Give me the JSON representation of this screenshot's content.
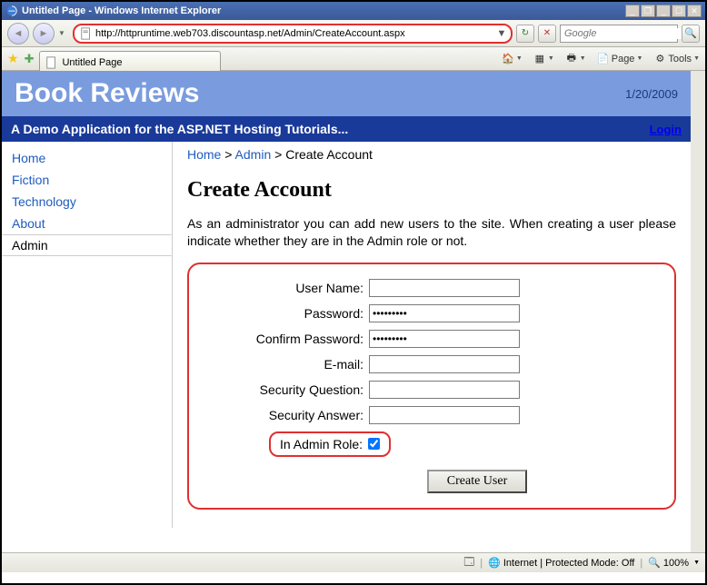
{
  "window": {
    "title": "Untitled Page - Windows Internet Explorer"
  },
  "address": {
    "url": "http://httpruntime.web703.discountasp.net/Admin/CreateAccount.aspx"
  },
  "search": {
    "placeholder": "Google"
  },
  "tabs": {
    "active": "Untitled Page"
  },
  "toolbar": {
    "home": "",
    "feeds": "",
    "print": "",
    "page": "Page",
    "tools": "Tools"
  },
  "site": {
    "title": "Book Reviews",
    "date": "1/20/2009",
    "tagline": "A Demo Application for the ASP.NET Hosting Tutorials...",
    "login": "Login"
  },
  "nav": {
    "items": [
      "Home",
      "Fiction",
      "Technology",
      "About",
      "Admin"
    ],
    "active": "Admin"
  },
  "breadcrumb": {
    "items": [
      "Home",
      "Admin",
      "Create Account"
    ]
  },
  "page": {
    "heading": "Create Account",
    "intro": "As an administrator you can add new users to the site. When creating a user please indicate whether they are in the Admin role or not."
  },
  "form": {
    "username_label": "User Name:",
    "username_value": "",
    "password_label": "Password:",
    "password_value": "password1",
    "confirm_label": "Confirm Password:",
    "confirm_value": "password1",
    "email_label": "E-mail:",
    "email_value": "",
    "question_label": "Security Question:",
    "question_value": "",
    "answer_label": "Security Answer:",
    "answer_value": "",
    "inrole_label": "In Admin Role:",
    "inrole_checked": true,
    "submit": "Create User"
  },
  "status": {
    "zone": "Internet | Protected Mode: Off",
    "zoom": "100%"
  }
}
